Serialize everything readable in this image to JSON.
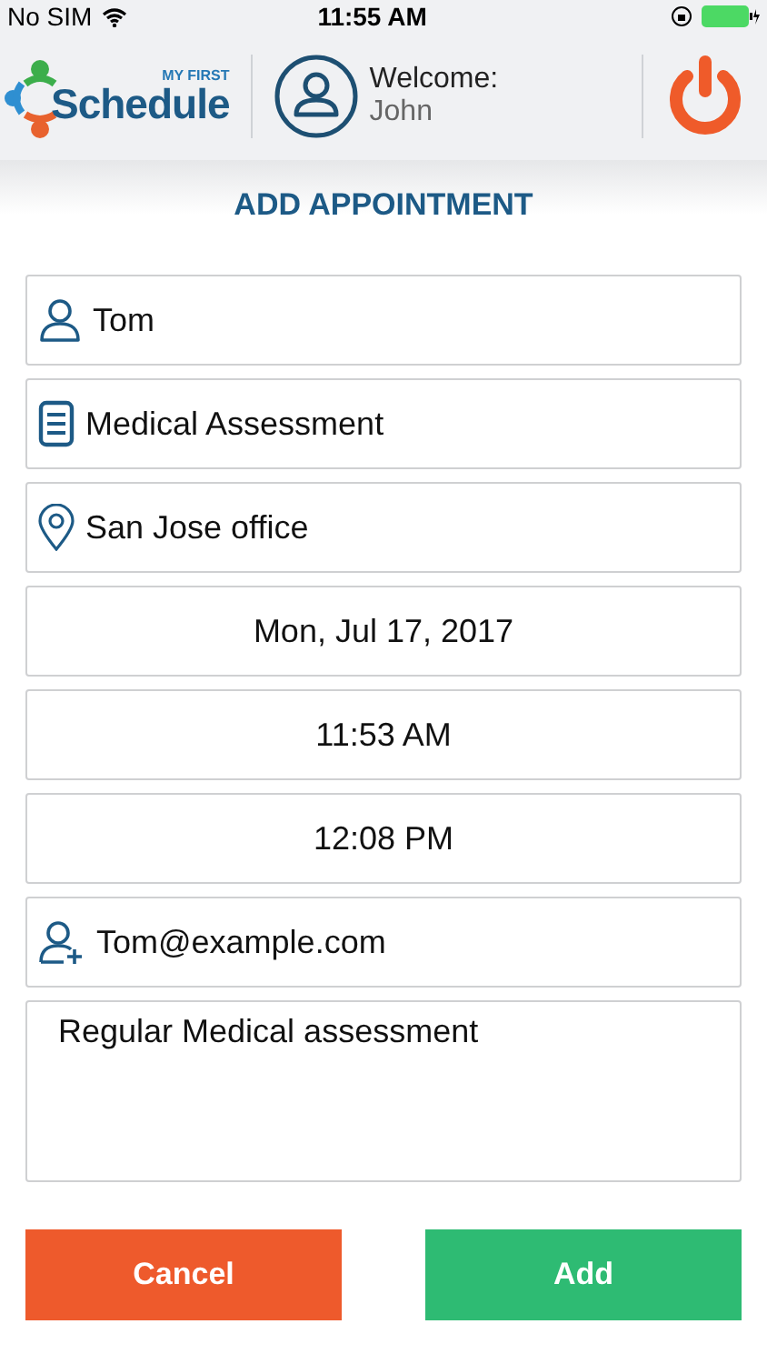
{
  "status_bar": {
    "carrier": "No SIM",
    "time": "11:55 AM"
  },
  "header": {
    "logo_small": "MY FIRST",
    "logo_big": "Schedule",
    "welcome": "Welcome:",
    "user": "John"
  },
  "title": "ADD APPOINTMENT",
  "fields": [
    {
      "kind": "person",
      "value": "Tom"
    },
    {
      "kind": "service",
      "value": "Medical Assessment"
    },
    {
      "kind": "location",
      "value": "San Jose office"
    },
    {
      "kind": "date",
      "value": "Mon, Jul 17, 2017"
    },
    {
      "kind": "time",
      "value": "11:53 AM"
    },
    {
      "kind": "time",
      "value": "12:08 PM"
    },
    {
      "kind": "email",
      "value": "Tom@example.com"
    },
    {
      "kind": "notes",
      "value": "Regular Medical assessment"
    }
  ],
  "buttons": [
    {
      "kind": "cancel",
      "label": "Cancel"
    },
    {
      "kind": "add",
      "label": "Add"
    }
  ]
}
